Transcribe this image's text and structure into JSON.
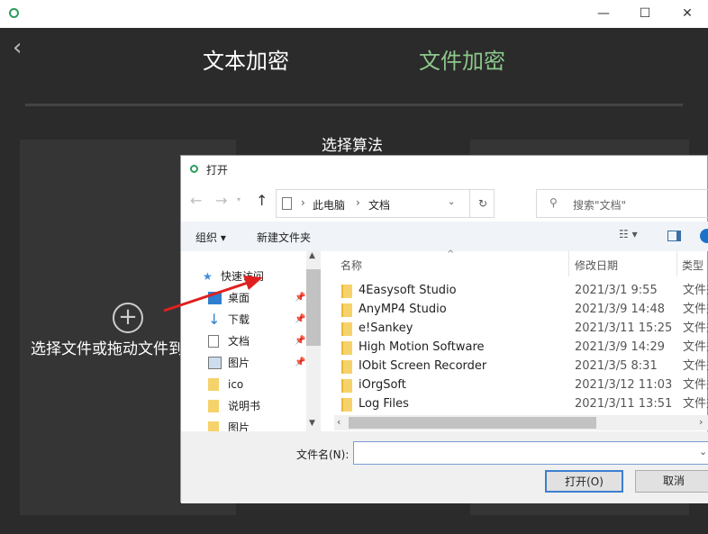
{
  "app": {
    "back_icon": "chevron-left-icon",
    "tabs": [
      {
        "label": "文本加密",
        "active": false
      },
      {
        "label": "文件加密",
        "active": true
      }
    ],
    "accent": "#8cc88c",
    "algo_label": "选择算法",
    "drop_text": "选择文件或拖动文件到",
    "add_icon": "plus-circle-icon"
  },
  "dialog": {
    "title": "打开",
    "breadcrumb": [
      "此电脑",
      "文档"
    ],
    "search_placeholder": "搜索\"文档\"",
    "organize": "组织 ▾",
    "new_folder": "新建文件夹",
    "nav": [
      {
        "label": "快速访问",
        "icon": "star-icon"
      },
      {
        "label": "桌面",
        "icon": "desktop-icon",
        "pinned": true
      },
      {
        "label": "下载",
        "icon": "download-icon",
        "pinned": true
      },
      {
        "label": "文档",
        "icon": "document-icon",
        "pinned": true
      },
      {
        "label": "图片",
        "icon": "picture-icon",
        "pinned": true
      },
      {
        "label": "ico",
        "icon": "folder-icon"
      },
      {
        "label": "说明书",
        "icon": "folder-icon"
      },
      {
        "label": "图片",
        "icon": "folder-icon"
      }
    ],
    "columns": {
      "name": "名称",
      "date": "修改日期",
      "type": "类型"
    },
    "files": [
      {
        "name": "4Easysoft Studio",
        "date": "2021/3/1 9:55",
        "type": "文件夹"
      },
      {
        "name": "AnyMP4 Studio",
        "date": "2021/3/9 14:48",
        "type": "文件夹"
      },
      {
        "name": "e!Sankey",
        "date": "2021/3/11 15:25",
        "type": "文件夹"
      },
      {
        "name": "High Motion Software",
        "date": "2021/3/9 14:29",
        "type": "文件夹"
      },
      {
        "name": "IObit Screen Recorder",
        "date": "2021/3/5 8:31",
        "type": "文件夹"
      },
      {
        "name": "iOrgSoft",
        "date": "2021/3/12 11:03",
        "type": "文件夹"
      },
      {
        "name": "Log Files",
        "date": "2021/3/11 13:51",
        "type": "文件夹"
      }
    ],
    "filename_label": "文件名(N):",
    "filename_value": "",
    "open_button": "打开(O)",
    "cancel_button": "取消"
  }
}
